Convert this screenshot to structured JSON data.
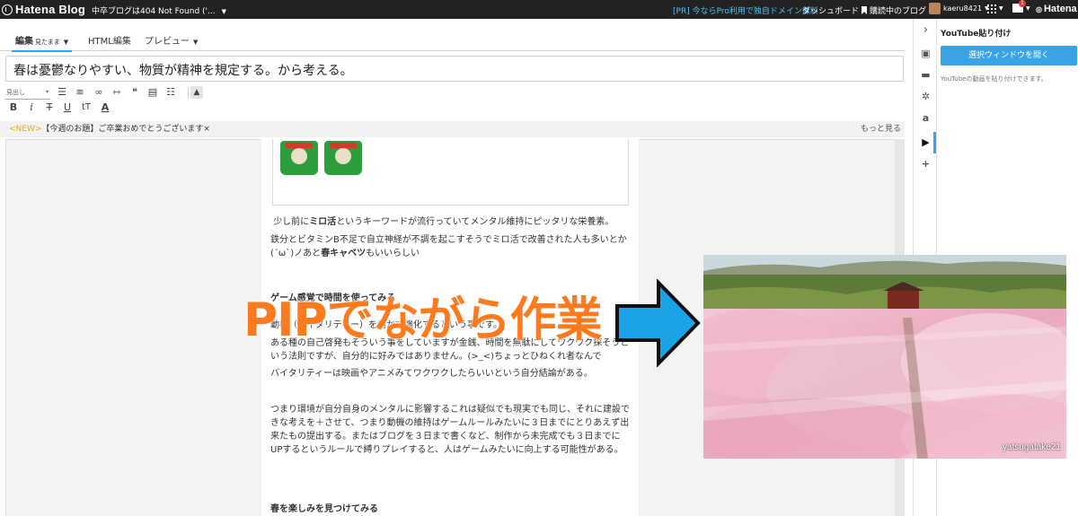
{
  "topbar": {
    "logo_text": "Hatena Blog",
    "blog_selector": "中卒ブログは404 Not Found ('...",
    "pr_link": "[PR] 今ならPro利用で独自ドメイン無料",
    "dashboard": "ダッシュボード",
    "reading": "購読中のブログ",
    "username": "kaeru8421",
    "notification_count": "1",
    "hatena": "Hatena"
  },
  "editor_tabs": {
    "edit": "編集",
    "edit_mode": "見たまま",
    "html": "HTML編集",
    "preview": "プレビュー"
  },
  "title_input": {
    "value": "春は憂鬱なりやすい、物質が精神を規定する。から考える。"
  },
  "toolbar": {
    "heading_select": "見出し"
  },
  "banner": {
    "new_tag": "<NEW>",
    "text": "【今週のお題】ご卒業おめでとうございます",
    "close": "×",
    "more": "もっと見る"
  },
  "article": {
    "p1_pre": "少し前に",
    "p1_bold": "ミロ活",
    "p1_post": "というキーワードが流行っていてメンタル維持にピッタリな栄養素。",
    "p2_pre": "鉄分とビタミンB不足で自立神経が不調を起こすそうでミロ活で改善された人も多いとか(´ω`)ノあと",
    "p2_bold": "春キャベツ",
    "p2_post": "もいいらしい",
    "p3_heading": "ゲーム感覚で時間を使ってみる",
    "p4": "動機（バイタリティー）を何かで強化するという事です。",
    "p5": "ある種の自己啓発もそういう事をしていますが金銭、時間を無駄にしてワクワク探そうという法則ですが、自分的に好みではありません。(>_<)ちょっとひねくれ者なんで",
    "p6": "バイタリティーは映画やアニメみてワクワクしたらいいという自分結論がある。",
    "p7": "つまり環境が自分自身のメンタルに影響するこれは疑似でも現実でも同じ、それに建設できな考えを＋させて、つまり動機の維持はゲームルールみたいに３日までにとりあえず出来たもの提出する。またはブログを３日まで書くなど、制作から未完成でも３日までにUPするというルールで縛りプレイすると、人はゲームみたいに向上する可能性がある。",
    "p8_heading": "春を楽しみを見つけてみる"
  },
  "sidebar": {
    "panel_title": "YouTube貼り付け",
    "panel_button": "選択ウィンドウを開く",
    "panel_note": "YouTubeの動画を貼り付けできます。"
  },
  "overlay": {
    "label": "PIPでながら作業",
    "video_caption": "yatsugatake21"
  },
  "colors": {
    "accent": "#3aa3e3",
    "overlay_text": "#ff7a1e",
    "arrow": "#1aa3e8",
    "new_tag": "#f2a21a"
  }
}
